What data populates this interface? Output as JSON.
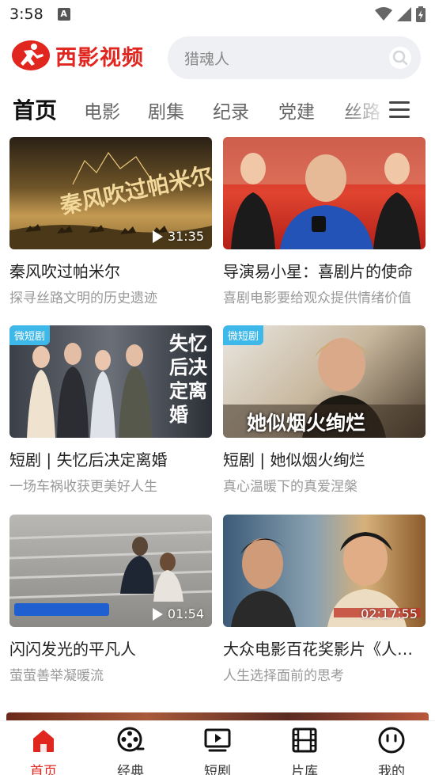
{
  "status_bar": {
    "time": "3:58",
    "notification_letter": "A"
  },
  "header": {
    "logo_text": "西影视频",
    "search_placeholder": "猎魂人"
  },
  "tabs": [
    "首页",
    "电影",
    "剧集",
    "纪录",
    "党建",
    "丝路"
  ],
  "active_tab": "首页",
  "cards": [
    {
      "title": "秦风吹过帕米尔",
      "subtitle": "探寻丝路文明的历史遗迹",
      "duration": "31:35",
      "badge": "",
      "thumb_text": "秦风吹过帕米尔"
    },
    {
      "title": "导演易小星：喜剧片的使命",
      "subtitle": "喜剧电影要给观众提供情绪价值",
      "duration": "",
      "badge": "",
      "thumb_text": ""
    },
    {
      "title": "短剧 | 失忆后决定离婚",
      "subtitle": "一场车祸收获更美好人生",
      "duration": "",
      "badge": "微短剧",
      "thumb_text": "失忆后决定离婚"
    },
    {
      "title": "短剧 | 她似烟火绚烂",
      "subtitle": "真心温暖下的真爱涅槃",
      "duration": "",
      "badge": "微短剧",
      "thumb_text": "她似烟火绚烂"
    },
    {
      "title": "闪闪发光的平凡人",
      "subtitle": "萤萤善举凝暖流",
      "duration": "01:54",
      "badge": "",
      "thumb_text": ""
    },
    {
      "title": "大众电影百花奖影片《人生》",
      "subtitle": "人生选择面前的思考",
      "duration": "02:17:55",
      "badge": "",
      "thumb_text": ""
    }
  ],
  "bottom_nav": [
    {
      "label": "首页",
      "icon": "home-icon",
      "active": true
    },
    {
      "label": "经典",
      "icon": "film-reel-icon",
      "active": false
    },
    {
      "label": "短剧",
      "icon": "play-screen-icon",
      "active": false
    },
    {
      "label": "片库",
      "icon": "film-strip-icon",
      "active": false
    },
    {
      "label": "我的",
      "icon": "profile-face-icon",
      "active": false
    }
  ],
  "colors": {
    "brand": "#e0261f",
    "badge": "#3eb8e8",
    "search_bg": "#eef0f3"
  }
}
